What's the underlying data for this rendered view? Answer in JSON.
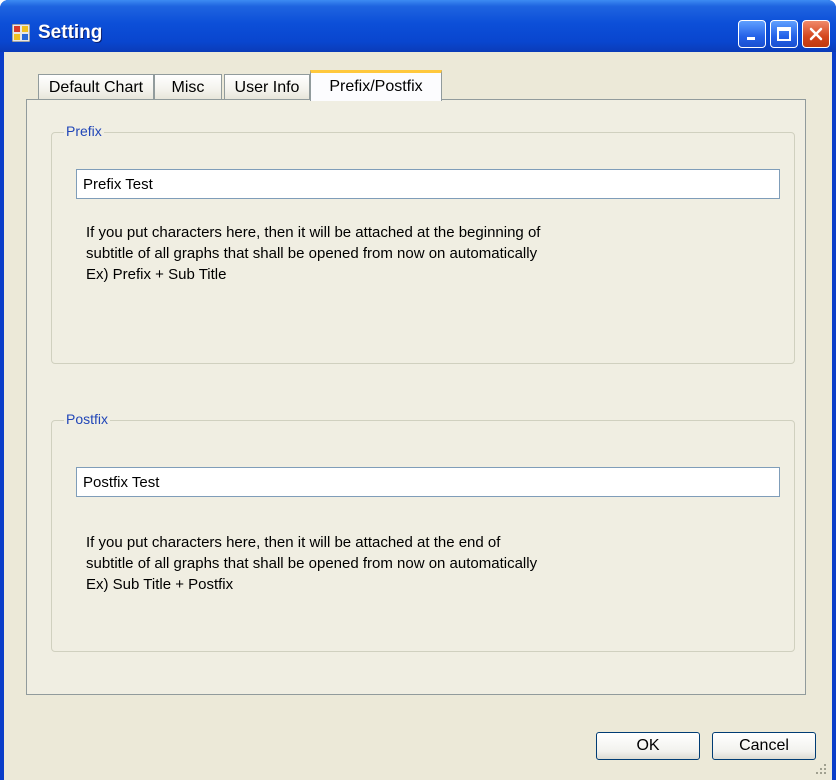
{
  "window": {
    "title": "Setting",
    "app_icon": "window-app-icon",
    "controls": [
      "minimize-icon",
      "maximize-icon",
      "close-icon"
    ]
  },
  "tabs": [
    {
      "label": "Default Chart",
      "active": false
    },
    {
      "label": "Misc",
      "active": false
    },
    {
      "label": "User Info",
      "active": false
    },
    {
      "label": "Prefix/Postfix",
      "active": true
    }
  ],
  "prefix": {
    "legend": "Prefix",
    "value": "Prefix Test",
    "description": [
      "If you put characters here,  then it will be attached at the beginning of",
      "subtitle of all graphs that shall be opened from now on automatically",
      "Ex) Prefix + Sub Title"
    ]
  },
  "postfix": {
    "legend": "Postfix",
    "value": "Postfix Test",
    "description": [
      "If you put characters here,  then it will be attached at the end of",
      "subtitle of all graphs that shall be opened from now on automatically",
      "Ex) Sub Title + Postfix"
    ]
  },
  "buttons": {
    "ok": "OK",
    "cancel": "Cancel"
  },
  "colors": {
    "titlebar": "#0c4fd8",
    "dialog_bg": "#ece9d8",
    "legend_text": "#2146b8",
    "active_tab_accent": "#ffc83c"
  }
}
